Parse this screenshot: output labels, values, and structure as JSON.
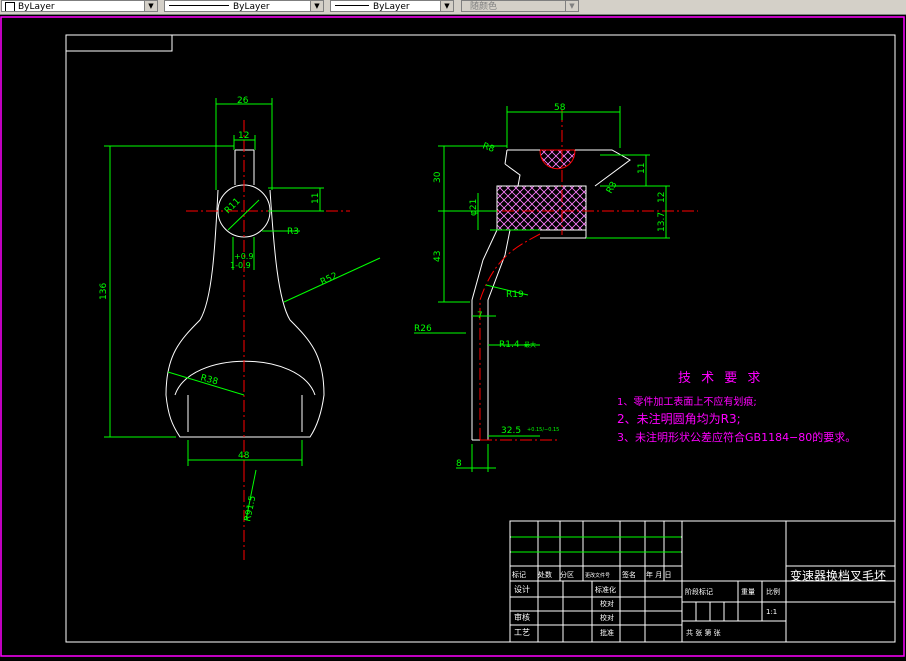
{
  "toolbar": {
    "color_value": "ByLayer",
    "linetype_value": "ByLayer",
    "lineweight_value": "ByLayer",
    "plotstyle_value": "随颜色"
  },
  "dims": {
    "d26": "26",
    "d12": "12",
    "d11a": "11",
    "r11": "R11",
    "r3a": "R3",
    "tol_up": "+0.9",
    "tol_dn": "1-0.9",
    "d136": "136",
    "r52": "R52",
    "r38": "R38",
    "d48": "48",
    "r91": "R91.5",
    "d58": "58",
    "r8": "R8",
    "d30": "30",
    "d11b": "11",
    "r3b": "R3",
    "phi21": "φ21",
    "d12b": "12",
    "d137": "13.7",
    "d43": "43",
    "r19": "R19",
    "r26": "R26",
    "d7": "7",
    "r14": "R1.4",
    "r14_note": "最大",
    "d325": "32.5",
    "d325_tol": "+0.15/−0.15",
    "d8": "8"
  },
  "notes": {
    "title": "技 术 要 求",
    "line1": "1、零件加工表面上不应有划痕;",
    "line2": "2、未注明圆角均为R3;",
    "line3": "3、未注明形状公差应符合GB1184−80的要求。"
  },
  "title_block": {
    "part_name": "变速器换档叉毛坯",
    "biaoji": "标记",
    "chushu": "处数",
    "fenqu": "分区",
    "gengai": "更改文件号",
    "qianming": "签名",
    "nianyueri": "年 月 日",
    "sheji": "设计",
    "biaozhunhua": "标准化",
    "tujie": "阶段标记",
    "zhongliang": "重量",
    "bili": "比例",
    "jiaodui": "校对",
    "shenhe": "审核",
    "gongyi": "工艺",
    "pizhun": "批准",
    "gongzhang": "共  张  第  张",
    "scale": "1:1"
  },
  "colors": {
    "bg": "#000000",
    "white": "#ffffff",
    "green": "#00ff00",
    "red": "#ff0000",
    "magenta": "#ff00ff",
    "hatch": "#ff80ff"
  }
}
